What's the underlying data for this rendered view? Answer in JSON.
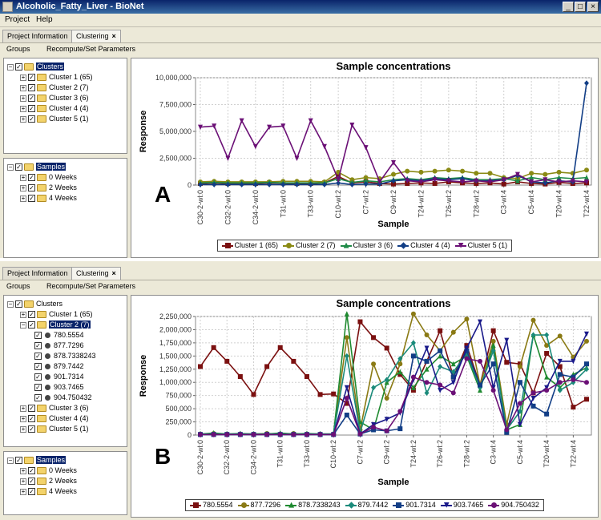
{
  "window": {
    "title": "Alcoholic_Fatty_Liver - BioNet"
  },
  "menu": {
    "project": "Project",
    "help": "Help"
  },
  "colors": [
    "#7b1010",
    "#8a8a14",
    "#1f8a47",
    "#123e86",
    "#6b1076"
  ],
  "panelA": {
    "label": "A",
    "tabs": {
      "info": "Project Information",
      "clustering": "Clustering",
      "close": "×"
    },
    "toolbar": {
      "groups": "Groups",
      "recompute": "Recompute/Set Parameters"
    },
    "tree_clusters": {
      "root": "Clusters",
      "items": [
        "Cluster 1 (65)",
        "Cluster 2 (7)",
        "Cluster 3 (6)",
        "Cluster 4 (4)",
        "Cluster 5 (1)"
      ]
    },
    "tree_samples": {
      "root": "Samples",
      "items": [
        "0 Weeks",
        "2 Weeks",
        "4 Weeks"
      ]
    },
    "chart_data": {
      "type": "line",
      "title": "Sample concentrations",
      "xlabel": "Sample",
      "ylabel": "Response",
      "ylim": [
        0,
        10000000
      ],
      "yticks": [
        "0",
        "2,500,000",
        "5,000,000",
        "7,500,000",
        "10,000,000"
      ],
      "xticks": [
        "C30-2-wl:0",
        "C32-2-wl:0",
        "C34-2-wl:0",
        "T31-wl:0",
        "T33-wl:0",
        "C10-wl:2",
        "C7-wl:2",
        "C9-wl:2",
        "T24-wl:2",
        "T26-wl:2",
        "T28-wl:2",
        "C3-wl:4",
        "C5-wl:4",
        "T20-wl:4",
        "T22-wl:4"
      ],
      "n_points": 29,
      "series": [
        {
          "name": "Cluster 1 (65)",
          "values": [
            150000,
            200000,
            150000,
            180000,
            150000,
            200000,
            180000,
            150000,
            150000,
            200000,
            800000,
            200000,
            300000,
            150000,
            100000,
            150000,
            200000,
            150000,
            300000,
            200000,
            150000,
            200000,
            100000,
            300000,
            150000,
            100000,
            250000,
            150000,
            200000
          ]
        },
        {
          "name": "Cluster 2 (7)",
          "values": [
            300000,
            350000,
            300000,
            300000,
            300000,
            300000,
            350000,
            350000,
            350000,
            300000,
            1200000,
            500000,
            700000,
            600000,
            1000000,
            1300000,
            1200000,
            1300000,
            1400000,
            1300000,
            1100000,
            1100000,
            700000,
            600000,
            1100000,
            1000000,
            1200000,
            1100000,
            1400000
          ]
        },
        {
          "name": "Cluster 3 (6)",
          "values": [
            200000,
            250000,
            200000,
            200000,
            200000,
            250000,
            200000,
            200000,
            200000,
            200000,
            600000,
            250000,
            400000,
            300000,
            500000,
            600000,
            500000,
            700000,
            600000,
            700000,
            500000,
            500000,
            600000,
            400000,
            700000,
            500000,
            700000,
            600000,
            700000
          ]
        },
        {
          "name": "Cluster 4 (4)",
          "values": [
            50000,
            50000,
            50000,
            50000,
            50000,
            50000,
            50000,
            50000,
            50000,
            50000,
            200000,
            50000,
            100000,
            100000,
            400000,
            500000,
            400000,
            600000,
            500000,
            600000,
            400000,
            400000,
            500000,
            900000,
            300000,
            200000,
            400000,
            300000,
            9500000
          ]
        },
        {
          "name": "Cluster 5 (1)",
          "values": [
            5400000,
            5500000,
            2500000,
            6000000,
            3600000,
            5400000,
            5500000,
            2500000,
            6000000,
            3600000,
            500000,
            5600000,
            3500000,
            300000,
            2100000,
            400000,
            300000,
            500000,
            400000,
            300000,
            400000,
            300000,
            500000,
            1000000,
            300000,
            500000,
            300000,
            400000,
            300000
          ]
        }
      ]
    }
  },
  "panelB": {
    "label": "B",
    "tabs": {
      "info": "Project Information",
      "clustering": "Clustering",
      "close": "×"
    },
    "toolbar": {
      "groups": "Groups",
      "recompute": "Recompute/Set Parameters"
    },
    "tree_clusters": {
      "root": "Clusters",
      "c1": "Cluster 1 (65)",
      "c2": "Cluster 2 (7)",
      "children": [
        "780.5554",
        "877.7296",
        "878.7338243",
        "879.7442",
        "901.7314",
        "903.7465",
        "904.750432"
      ],
      "rest": [
        "Cluster 3 (6)",
        "Cluster 4 (4)",
        "Cluster 5 (1)"
      ]
    },
    "tree_samples": {
      "root": "Samples",
      "items": [
        "0 Weeks",
        "2 Weeks",
        "4 Weeks"
      ]
    },
    "chart_data": {
      "type": "line",
      "title": "Sample concentrations",
      "xlabel": "Sample",
      "ylabel": "Response",
      "ylim": [
        0,
        2250000
      ],
      "yticks": [
        "0",
        "250,000",
        "500,000",
        "750,000",
        "1,000,000",
        "1,250,000",
        "1,500,000",
        "1,750,000",
        "2,000,000",
        "2,250,000"
      ],
      "xticks": [
        "C30-2-wl:0",
        "C32-2-wl:0",
        "C34-2-wl:0",
        "T31-wl:0",
        "T33-wl:0",
        "C10-wl:2",
        "C7-wl:2",
        "C9-wl:2",
        "T24-wl:2",
        "T26-wl:2",
        "T28-wl:2",
        "C3-wl:4",
        "C5-wl:4",
        "T20-wl:4",
        "T22-wl:4"
      ],
      "n_points": 30,
      "series": [
        {
          "name": "780.5554",
          "values": [
            1300000,
            1660000,
            1400000,
            1110000,
            770000,
            1300000,
            1660000,
            1400000,
            1110000,
            770000,
            780000,
            600000,
            2150000,
            1850000,
            1650000,
            1150000,
            850000,
            1400000,
            1980000,
            1100000,
            1700000,
            950000,
            1980000,
            1380000,
            1350000,
            800000,
            1550000,
            1300000,
            530000,
            680000
          ]
        },
        {
          "name": "877.7296",
          "values": [
            20000,
            30000,
            20000,
            20000,
            20000,
            30000,
            20000,
            30000,
            20000,
            20000,
            20000,
            1850000,
            100000,
            1350000,
            700000,
            1350000,
            2300000,
            1900000,
            1600000,
            1950000,
            2200000,
            950000,
            1780000,
            200000,
            1300000,
            2180000,
            1700000,
            1880000,
            1480000,
            1780000
          ]
        },
        {
          "name": "878.7338243",
          "values": [
            20000,
            40000,
            20000,
            30000,
            20000,
            20000,
            40000,
            20000,
            30000,
            20000,
            20000,
            2300000,
            250000,
            100000,
            1000000,
            1200000,
            900000,
            1250000,
            1500000,
            1350000,
            1500000,
            850000,
            1700000,
            100000,
            200000,
            1900000,
            1100000,
            900000,
            1150000,
            1280000
          ]
        },
        {
          "name": "879.7442",
          "values": [
            20000,
            20000,
            20000,
            20000,
            20000,
            20000,
            20000,
            20000,
            20000,
            20000,
            20000,
            1500000,
            50000,
            900000,
            1050000,
            1450000,
            1750000,
            800000,
            1300000,
            1200000,
            1550000,
            900000,
            1600000,
            100000,
            450000,
            1900000,
            1900000,
            850000,
            1000000,
            1250000
          ]
        },
        {
          "name": "901.7314",
          "values": [
            10000,
            10000,
            10000,
            10000,
            10000,
            10000,
            10000,
            10000,
            10000,
            10000,
            10000,
            380000,
            20000,
            100000,
            80000,
            120000,
            1500000,
            1400000,
            1600000,
            1100000,
            1600000,
            950000,
            1350000,
            50000,
            1000000,
            550000,
            400000,
            1150000,
            1100000,
            1350000
          ]
        },
        {
          "name": "903.7465",
          "values": [
            10000,
            10000,
            10000,
            10000,
            10000,
            10000,
            10000,
            10000,
            10000,
            10000,
            10000,
            900000,
            20000,
            200000,
            300000,
            420000,
            1050000,
            1650000,
            850000,
            1000000,
            1650000,
            2150000,
            900000,
            1800000,
            200000,
            700000,
            900000,
            1400000,
            1400000,
            1920000
          ]
        },
        {
          "name": "904.750432",
          "values": [
            10000,
            10000,
            10000,
            10000,
            10000,
            10000,
            10000,
            10000,
            10000,
            10000,
            10000,
            700000,
            20000,
            150000,
            80000,
            450000,
            1100000,
            1000000,
            950000,
            800000,
            1450000,
            1400000,
            850000,
            100000,
            600000,
            800000,
            850000,
            1000000,
            1050000,
            1000000
          ]
        }
      ],
      "colors": [
        "#7b1010",
        "#8a7a14",
        "#1f8a30",
        "#1a8a7a",
        "#123e86",
        "#1a1a8a",
        "#6b1076"
      ],
      "markers": [
        "square",
        "circle",
        "triangle",
        "diamond",
        "square",
        "triangle-down",
        "circle"
      ]
    }
  }
}
